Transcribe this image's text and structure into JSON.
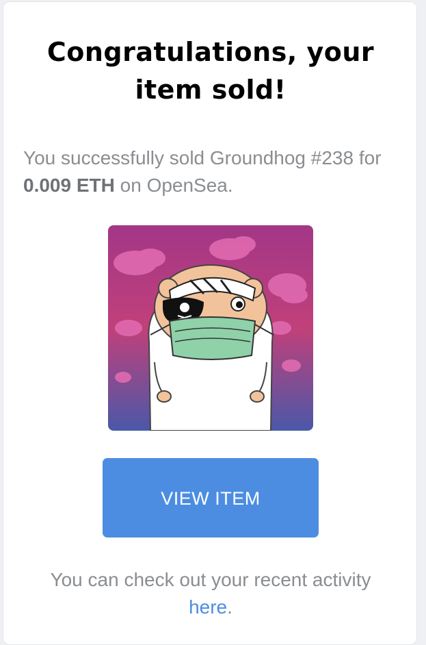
{
  "email": {
    "heading_line1": "Congratulations, your",
    "heading_line2": "item sold!",
    "desc_prefix": "You successfully sold Groundhog #238 for ",
    "price": "0.009 ETH",
    "desc_suffix": " on OpenSea.",
    "nft_icon": "pirate-groundhog-nft-icon",
    "button_label": "VIEW ITEM",
    "footer_text": "You can check out your recent activity ",
    "footer_link": "here",
    "footer_end": "."
  },
  "colors": {
    "button": "#4c8de2",
    "link": "#4c8de2",
    "muted_text": "#8a8d91",
    "art_top": "#b0367e",
    "art_bottom": "#4a58a8"
  }
}
